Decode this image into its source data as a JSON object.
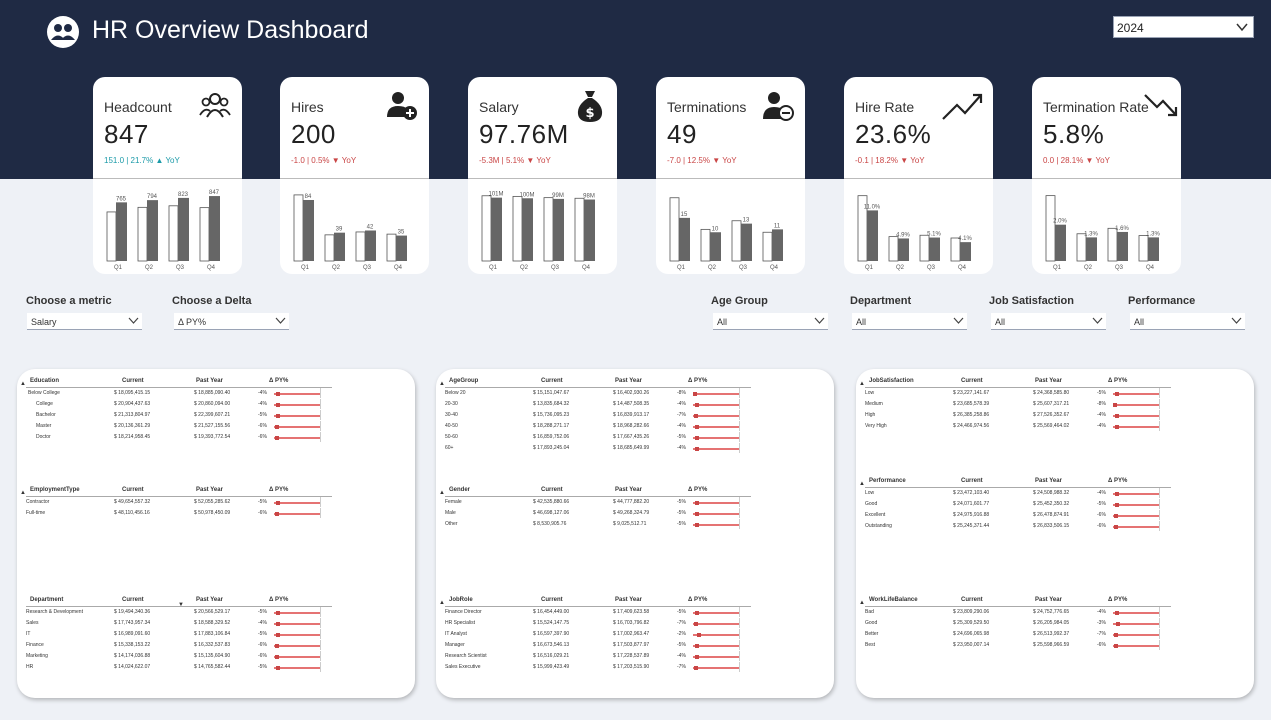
{
  "app": {
    "title": "HR Overview Dashboard",
    "year": "2024"
  },
  "colors": {
    "header_bg": "#1f2a44",
    "bar_dark": "#666666",
    "delta_up": "#1a9aa8",
    "delta_down": "#c94545",
    "delta_bar": "#e57373"
  },
  "kpis": [
    {
      "label": "Headcount",
      "value": "847",
      "delta": "151.0 | 21.7% ▲ YoY",
      "direction": "up",
      "icon": "people-group-icon",
      "chart": {
        "categories": [
          "Q1",
          "Q2",
          "Q3",
          "Q4"
        ],
        "current": [
          765,
          794,
          823,
          847
        ],
        "prior": [
          640,
          700,
          720,
          696
        ],
        "labels": [
          "765",
          "794",
          "823",
          "847"
        ],
        "ymax": 900
      }
    },
    {
      "label": "Hires",
      "value": "200",
      "delta": "-1.0 | 0.5% ▼ YoY",
      "direction": "down",
      "icon": "person-add-icon",
      "chart": {
        "categories": [
          "Q1",
          "Q2",
          "Q3",
          "Q4"
        ],
        "current": [
          84,
          39,
          42,
          35
        ],
        "prior": [
          91,
          36,
          40,
          37
        ],
        "labels": [
          "84",
          "39",
          "42",
          "35"
        ],
        "ymax": 95
      }
    },
    {
      "label": "Salary",
      "value": "97.76M",
      "delta": "-5.3M | 5.1% ▼ YoY",
      "direction": "down",
      "icon": "money-bag-icon",
      "chart": {
        "categories": [
          "Q1",
          "Q2",
          "Q3",
          "Q4"
        ],
        "current": [
          101,
          100,
          99,
          98
        ],
        "prior": [
          104,
          103,
          101,
          100
        ],
        "labels": [
          "101M",
          "100M",
          "99M",
          "98M"
        ],
        "ymax": 110
      }
    },
    {
      "label": "Terminations",
      "value": "49",
      "delta": "-7.0 | 12.5% ▼ YoY",
      "direction": "down",
      "icon": "person-remove-icon",
      "chart": {
        "categories": [
          "Q1",
          "Q2",
          "Q3",
          "Q4"
        ],
        "current": [
          15,
          10,
          13,
          11
        ],
        "prior": [
          22,
          11,
          14,
          10
        ],
        "labels": [
          "15",
          "10",
          "13",
          "11"
        ],
        "ymax": 24
      }
    },
    {
      "label": "Hire Rate",
      "value": "23.6%",
      "delta": "-0.1 | 18.2% ▼ YoY",
      "direction": "down",
      "icon": "trend-up-icon",
      "chart": {
        "categories": [
          "Q1",
          "Q2",
          "Q3",
          "Q4"
        ],
        "current": [
          11.0,
          4.9,
          5.1,
          4.1
        ],
        "prior": [
          14.2,
          5.3,
          5.6,
          5.0
        ],
        "labels": [
          "11.0%",
          "4.9%",
          "5.1%",
          "4.1%"
        ],
        "ymax": 15
      }
    },
    {
      "label": "Termination Rate",
      "value": "5.8%",
      "delta": "0.0 | 28.1% ▼ YoY",
      "direction": "down",
      "icon": "trend-down-icon",
      "chart": {
        "categories": [
          "Q1",
          "Q2",
          "Q3",
          "Q4"
        ],
        "current": [
          2.0,
          1.3,
          1.6,
          1.3
        ],
        "prior": [
          3.6,
          1.5,
          1.8,
          1.4
        ],
        "labels": [
          "2.0%",
          "1.3%",
          "1.6%",
          "1.3%"
        ],
        "ymax": 3.8
      }
    }
  ],
  "controls": {
    "metric": {
      "label": "Choose a metric",
      "value": "Salary"
    },
    "delta": {
      "label": "Choose a Delta",
      "value": "Δ PY%"
    },
    "age_group": {
      "label": "Age Group",
      "value": "All"
    },
    "department": {
      "label": "Department",
      "value": "All"
    },
    "job_satisfaction": {
      "label": "Job Satisfaction",
      "value": "All"
    },
    "performance": {
      "label": "Performance",
      "value": "All"
    }
  },
  "tables": {
    "education": {
      "headers": [
        "Education",
        "Current",
        "Past Year",
        "Δ PY%"
      ],
      "rows": [
        {
          "name": "Below College",
          "current": "$ 18,095,415.15",
          "past": "$ 18,885,090.40",
          "delta": "-4%",
          "pct": -4
        },
        {
          "name": "College",
          "current": "$ 20,904,437.63",
          "past": "$ 20,860,094.00",
          "delta": "-4%",
          "pct": -4
        },
        {
          "name": "Bachelor",
          "current": "$ 21,313,804.97",
          "past": "$ 22,399,607.21",
          "delta": "-5%",
          "pct": -5
        },
        {
          "name": "Master",
          "current": "$ 20,136,361.29",
          "past": "$ 21,527,155.56",
          "delta": "-6%",
          "pct": -6
        },
        {
          "name": "Doctor",
          "current": "$ 18,214,958.45",
          "past": "$ 19,393,772.54",
          "delta": "-6%",
          "pct": -6
        }
      ]
    },
    "employment_type": {
      "headers": [
        "EmploymentType",
        "Current",
        "Past Year",
        "Δ PY%"
      ],
      "rows": [
        {
          "name": "Contractor",
          "current": "$ 49,654,557.32",
          "past": "$ 52,055,285.62",
          "delta": "-5%",
          "pct": -5
        },
        {
          "name": "Full-time",
          "current": "$ 48,110,456.16",
          "past": "$ 50,978,450.09",
          "delta": "-6%",
          "pct": -6
        }
      ]
    },
    "department": {
      "headers": [
        "Department",
        "Current",
        "Past Year",
        "Δ PY%"
      ],
      "rows": [
        {
          "name": "Research & Development",
          "current": "$ 19,494,340.36",
          "past": "$ 20,566,529.17",
          "delta": "-5%",
          "pct": -5
        },
        {
          "name": "Sales",
          "current": "$ 17,743,957.34",
          "past": "$ 18,588,329.52",
          "delta": "-4%",
          "pct": -4
        },
        {
          "name": "IT",
          "current": "$ 16,989,091.60",
          "past": "$ 17,883,106.84",
          "delta": "-5%",
          "pct": -5
        },
        {
          "name": "Finance",
          "current": "$ 15,338,153.22",
          "past": "$ 16,332,537.83",
          "delta": "-6%",
          "pct": -6
        },
        {
          "name": "Marketing",
          "current": "$ 14,174,036.88",
          "past": "$ 15,135,604.90",
          "delta": "-6%",
          "pct": -6
        },
        {
          "name": "HR",
          "current": "$ 14,024,622.07",
          "past": "$ 14,765,582.44",
          "delta": "-5%",
          "pct": -5
        }
      ]
    },
    "age_group": {
      "headers": [
        "AgeGroup",
        "Current",
        "Past Year",
        "Δ PY%"
      ],
      "rows": [
        {
          "name": "Below 20",
          "current": "$ 15,151,047.67",
          "past": "$ 16,402,930.26",
          "delta": "-8%",
          "pct": -8
        },
        {
          "name": "20-30",
          "current": "$ 13,835,684.32",
          "past": "$ 14,487,508.35",
          "delta": "-4%",
          "pct": -4
        },
        {
          "name": "30-40",
          "current": "$ 15,736,095.23",
          "past": "$ 16,839,913.17",
          "delta": "-7%",
          "pct": -7
        },
        {
          "name": "40-50",
          "current": "$ 18,288,271.17",
          "past": "$ 18,968,282.66",
          "delta": "-4%",
          "pct": -4
        },
        {
          "name": "50-60",
          "current": "$ 16,859,752.06",
          "past": "$ 17,667,435.26",
          "delta": "-5%",
          "pct": -5
        },
        {
          "name": "60+",
          "current": "$ 17,893,245.04",
          "past": "$ 18,685,649.99",
          "delta": "-4%",
          "pct": -4
        }
      ]
    },
    "gender": {
      "headers": [
        "Gender",
        "Current",
        "Past Year",
        "Δ PY%"
      ],
      "rows": [
        {
          "name": "Female",
          "current": "$ 42,535,880.66",
          "past": "$ 44,777,882.20",
          "delta": "-5%",
          "pct": -5
        },
        {
          "name": "Male",
          "current": "$ 46,698,127.06",
          "past": "$ 49,268,324.79",
          "delta": "-5%",
          "pct": -5
        },
        {
          "name": "Other",
          "current": "$ 8,530,905.76",
          "past": "$ 9,025,512.71",
          "delta": "-5%",
          "pct": -5
        }
      ]
    },
    "job_role": {
      "headers": [
        "JobRole",
        "Current",
        "Past Year",
        "Δ PY%"
      ],
      "rows": [
        {
          "name": "Finance Director",
          "current": "$ 16,454,449.00",
          "past": "$ 17,409,623.58",
          "delta": "-5%",
          "pct": -5
        },
        {
          "name": "HR Specialist",
          "current": "$ 15,524,147.75",
          "past": "$ 16,703,796.82",
          "delta": "-7%",
          "pct": -7
        },
        {
          "name": "IT Analyst",
          "current": "$ 16,597,397.90",
          "past": "$ 17,002,963.47",
          "delta": "-2%",
          "pct": -2
        },
        {
          "name": "Manager",
          "current": "$ 16,673,546.13",
          "past": "$ 17,503,877.97",
          "delta": "-5%",
          "pct": -5
        },
        {
          "name": "Research Scientist",
          "current": "$ 16,516,029.21",
          "past": "$ 17,228,537.89",
          "delta": "-4%",
          "pct": -4
        },
        {
          "name": "Sales Executive",
          "current": "$ 15,999,423.49",
          "past": "$ 17,203,515.90",
          "delta": "-7%",
          "pct": -7
        }
      ]
    },
    "job_satisfaction": {
      "headers": [
        "JobSatisfaction",
        "Current",
        "Past Year",
        "Δ PY%"
      ],
      "rows": [
        {
          "name": "Low",
          "current": "$ 23,227,141.67",
          "past": "$ 24,368,585.80",
          "delta": "-5%",
          "pct": -5
        },
        {
          "name": "Medium",
          "current": "$ 23,685,578.39",
          "past": "$ 25,607,317.21",
          "delta": "-8%",
          "pct": -8
        },
        {
          "name": "High",
          "current": "$ 26,385,258.86",
          "past": "$ 27,526,352.67",
          "delta": "-4%",
          "pct": -4
        },
        {
          "name": "Very High",
          "current": "$ 24,466,974.56",
          "past": "$ 25,569,464.02",
          "delta": "-4%",
          "pct": -4
        }
      ]
    },
    "performance": {
      "headers": [
        "Performance",
        "Current",
        "Past Year",
        "Δ PY%"
      ],
      "rows": [
        {
          "name": "Low",
          "current": "$ 23,472,103.40",
          "past": "$ 24,508,988.32",
          "delta": "-4%",
          "pct": -4
        },
        {
          "name": "Good",
          "current": "$ 24,071,601.77",
          "past": "$ 25,452,350.32",
          "delta": "-5%",
          "pct": -5
        },
        {
          "name": "Excellent",
          "current": "$ 24,975,916.88",
          "past": "$ 26,478,874.91",
          "delta": "-6%",
          "pct": -6
        },
        {
          "name": "Outstanding",
          "current": "$ 25,245,371.44",
          "past": "$ 26,833,506.15",
          "delta": "-6%",
          "pct": -6
        }
      ]
    },
    "work_life_balance": {
      "headers": [
        "WorkLifeBalance",
        "Current",
        "Past Year",
        "Δ PY%"
      ],
      "rows": [
        {
          "name": "Bad",
          "current": "$ 23,809,290.06",
          "past": "$ 24,752,776.65",
          "delta": "-4%",
          "pct": -4
        },
        {
          "name": "Good",
          "current": "$ 25,309,529.50",
          "past": "$ 26,205,984.05",
          "delta": "-3%",
          "pct": -3
        },
        {
          "name": "Better",
          "current": "$ 24,696,065.98",
          "past": "$ 26,513,992.37",
          "delta": "-7%",
          "pct": -7
        },
        {
          "name": "Best",
          "current": "$ 23,950,007.14",
          "past": "$ 25,598,966.59",
          "delta": "-6%",
          "pct": -6
        }
      ]
    }
  }
}
